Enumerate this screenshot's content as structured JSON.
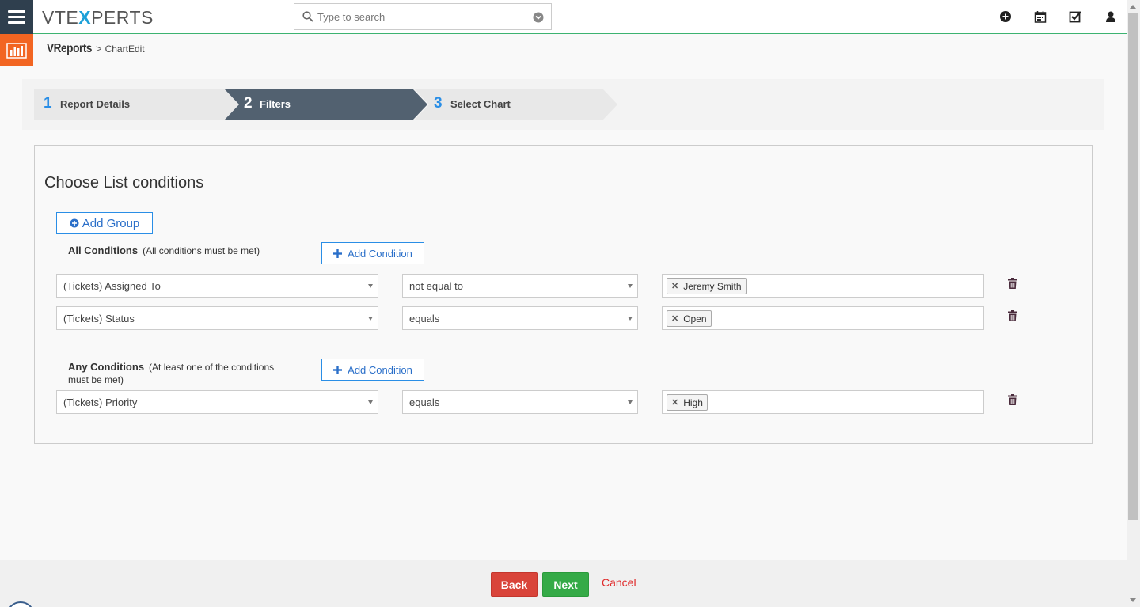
{
  "topbar": {
    "logo_left": "VTE",
    "logo_x": "X",
    "logo_right": "PERTS",
    "search_placeholder": "Type to search",
    "accent_color": "#3cb371"
  },
  "breadcrumb": {
    "module": "VReports",
    "separator": ">",
    "page": "ChartEdit"
  },
  "wizard": {
    "steps": [
      {
        "number": "1",
        "label": "Report Details",
        "active": false
      },
      {
        "number": "2",
        "label": "Filters",
        "active": true
      },
      {
        "number": "3",
        "label": "Select Chart",
        "active": false
      }
    ]
  },
  "conditions": {
    "title": "Choose List conditions",
    "add_group_label": "Add Group",
    "all": {
      "label": "All Conditions",
      "hint": "(All conditions must be met)",
      "add_condition_label": "Add Condition",
      "rows": [
        {
          "field": "(Tickets) Assigned To",
          "operator": "not equal to",
          "value": "Jeremy Smith"
        },
        {
          "field": "(Tickets) Status",
          "operator": "equals",
          "value": "Open"
        }
      ]
    },
    "any": {
      "label": "Any Conditions",
      "hint_line1": "(At least one of the conditions",
      "hint_line2": "must be met)",
      "add_condition_label": "Add Condition",
      "rows": [
        {
          "field": "(Tickets) Priority",
          "operator": "equals",
          "value": "High"
        }
      ]
    }
  },
  "footer": {
    "back_label": "Back",
    "next_label": "Next",
    "cancel_label": "Cancel"
  }
}
